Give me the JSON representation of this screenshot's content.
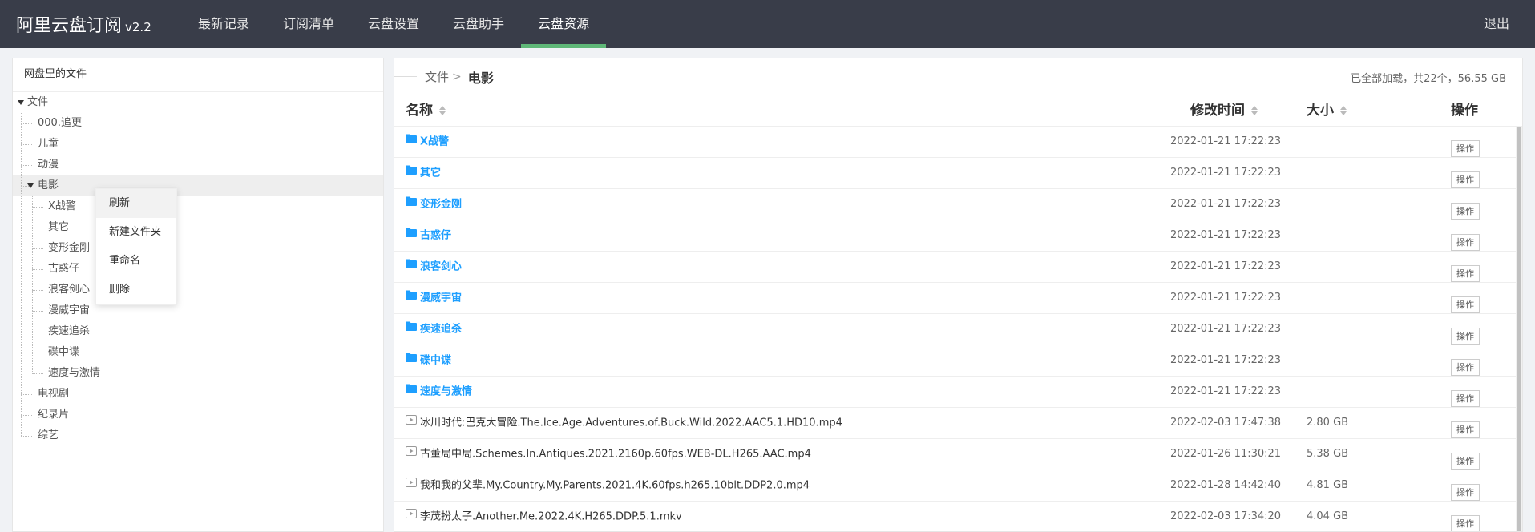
{
  "header": {
    "app_title": "阿里云盘订阅",
    "version": "v2.2",
    "nav": [
      {
        "label": "最新记录",
        "active": false
      },
      {
        "label": "订阅清单",
        "active": false
      },
      {
        "label": "云盘设置",
        "active": false
      },
      {
        "label": "云盘助手",
        "active": false
      },
      {
        "label": "云盘资源",
        "active": true
      }
    ],
    "logout_label": "退出",
    "accent_color": "#5fb878",
    "bg_color": "#393d49"
  },
  "sidebar": {
    "title": "网盘里的文件",
    "root": "文件",
    "items": [
      {
        "label": "000.追更"
      },
      {
        "label": "儿童"
      },
      {
        "label": "动漫"
      },
      {
        "label": "电影",
        "expanded": true,
        "selected": true,
        "children": [
          "X战警",
          "其它",
          "变形金刚",
          "古惑仔",
          "浪客剑心",
          "漫威宇宙",
          "疾速追杀",
          "碟中谍",
          "速度与激情"
        ]
      },
      {
        "label": "电视剧"
      },
      {
        "label": "纪录片"
      },
      {
        "label": "综艺"
      }
    ]
  },
  "context_menu": {
    "items": [
      "刷新",
      "新建文件夹",
      "重命名",
      "删除"
    ],
    "hovered_index": 0
  },
  "main": {
    "breadcrumb": {
      "root": "文件",
      "separator": ">",
      "current": "电影"
    },
    "summary": "已全部加载，共22个，56.55 GB",
    "columns": {
      "name": "名称",
      "modified": "修改时间",
      "size": "大小",
      "action": "操作"
    },
    "rows": [
      {
        "type": "folder",
        "name": "X战警",
        "modified": "2022-01-21 17:22:23",
        "size": "",
        "action": "操作"
      },
      {
        "type": "folder",
        "name": "其它",
        "modified": "2022-01-21 17:22:23",
        "size": "",
        "action": "操作"
      },
      {
        "type": "folder",
        "name": "变形金刚",
        "modified": "2022-01-21 17:22:23",
        "size": "",
        "action": "操作"
      },
      {
        "type": "folder",
        "name": "古惑仔",
        "modified": "2022-01-21 17:22:23",
        "size": "",
        "action": "操作"
      },
      {
        "type": "folder",
        "name": "浪客剑心",
        "modified": "2022-01-21 17:22:23",
        "size": "",
        "action": "操作"
      },
      {
        "type": "folder",
        "name": "漫威宇宙",
        "modified": "2022-01-21 17:22:23",
        "size": "",
        "action": "操作"
      },
      {
        "type": "folder",
        "name": "疾速追杀",
        "modified": "2022-01-21 17:22:23",
        "size": "",
        "action": "操作"
      },
      {
        "type": "folder",
        "name": "碟中谍",
        "modified": "2022-01-21 17:22:23",
        "size": "",
        "action": "操作"
      },
      {
        "type": "folder",
        "name": "速度与激情",
        "modified": "2022-01-21 17:22:23",
        "size": "",
        "action": "操作"
      },
      {
        "type": "video",
        "name": "冰川时代:巴克大冒险.The.Ice.Age.Adventures.of.Buck.Wild.2022.AAC5.1.HD10.mp4",
        "modified": "2022-02-03 17:47:38",
        "size": "2.80 GB",
        "action": "操作"
      },
      {
        "type": "video",
        "name": "古董局中局.Schemes.In.Antiques.2021.2160p.60fps.WEB-DL.H265.AAC.mp4",
        "modified": "2022-01-26 11:30:21",
        "size": "5.38 GB",
        "action": "操作"
      },
      {
        "type": "video",
        "name": "我和我的父辈.My.Country.My.Parents.2021.4K.60fps.h265.10bit.DDP2.0.mp4",
        "modified": "2022-01-28 14:42:40",
        "size": "4.81 GB",
        "action": "操作"
      },
      {
        "type": "video",
        "name": "李茂扮太子.Another.Me.2022.4K.H265.DDP.5.1.mkv",
        "modified": "2022-02-03 17:34:20",
        "size": "4.04 GB",
        "action": "操作"
      }
    ]
  }
}
